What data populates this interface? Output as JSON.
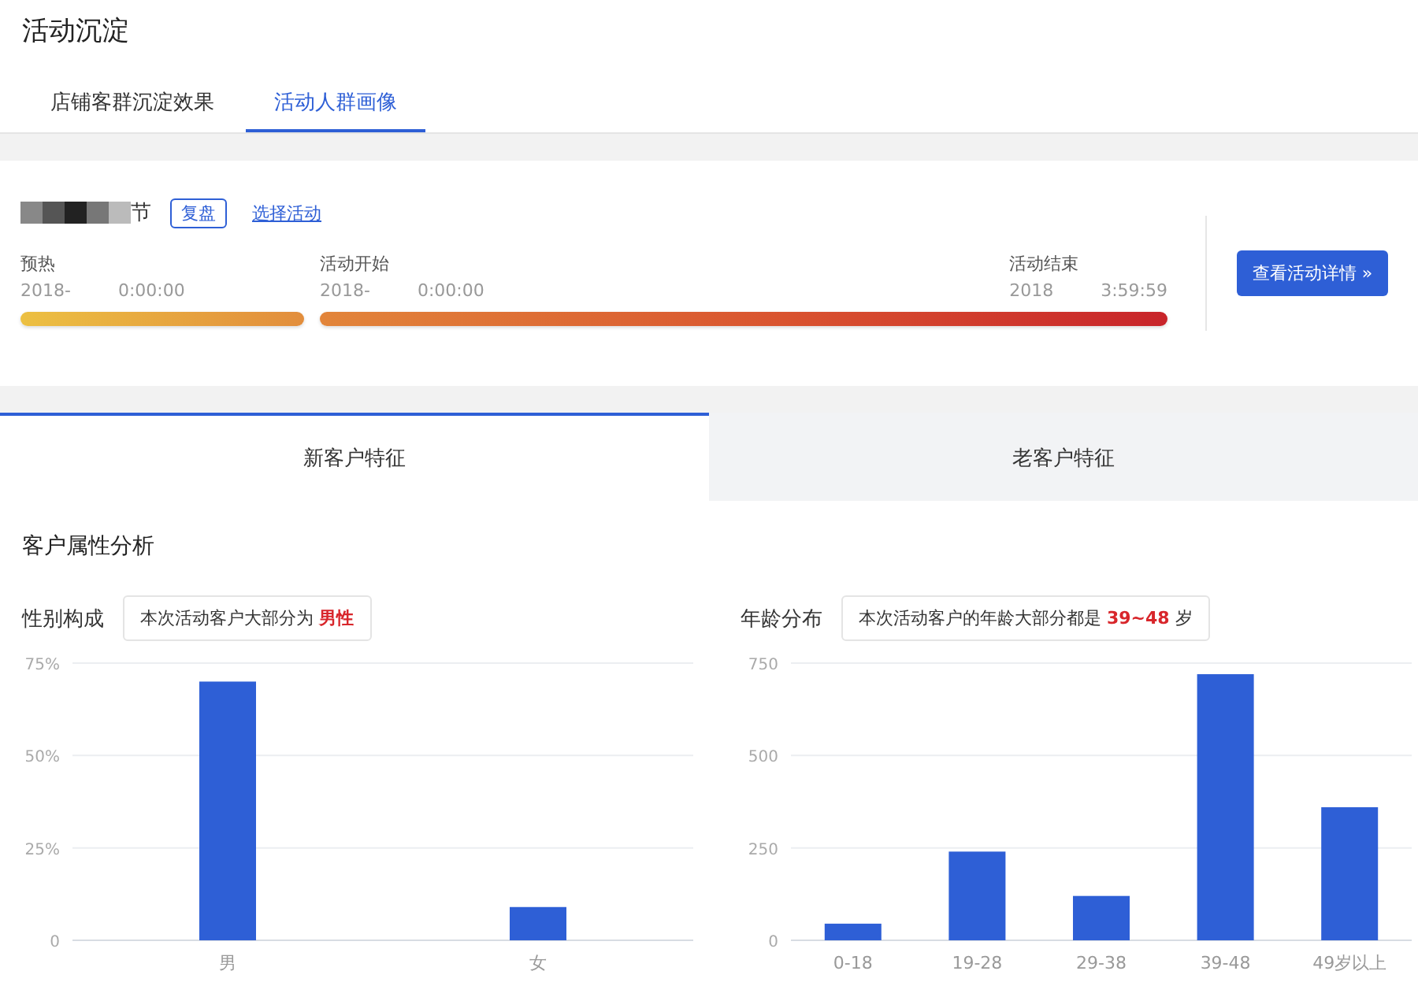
{
  "page_title": "活动沉淀",
  "tabs": [
    {
      "label": "店铺客群沉淀效果",
      "selected": false
    },
    {
      "label": "活动人群画像",
      "selected": true
    }
  ],
  "activity": {
    "name": "节",
    "tag": "复盘",
    "select_link": "选择活动",
    "detail_button": "查看活动详情 »",
    "segments": [
      {
        "kind": "warmup",
        "start": {
          "label": "预热",
          "date": "2018-",
          "time": "0:00:00"
        }
      },
      {
        "kind": "active",
        "start": {
          "label": "活动开始",
          "date": "2018-",
          "time": "0:00:00"
        },
        "end": {
          "label": "活动结束",
          "date": "2018",
          "time": "3:59:59"
        }
      }
    ]
  },
  "customer_tabs": [
    {
      "label": "新客户特征",
      "selected": true
    },
    {
      "label": "老客户特征",
      "selected": false
    }
  ],
  "section_title": "客户属性分析",
  "panels": [
    {
      "title": "性别构成",
      "note": "本次活动客户大部分为 **男性**",
      "chart_data": {
        "type": "bar",
        "categories": [
          "男",
          "女"
        ],
        "series": [
          {
            "color": "#2e5fd6",
            "values": [
              70,
              9
            ]
          }
        ],
        "ylim": [
          0,
          75
        ],
        "yticks": [
          {
            "value": 0,
            "label": "0"
          },
          {
            "value": 25,
            "label": "25%"
          },
          {
            "value": 50,
            "label": "50%"
          },
          {
            "value": 75,
            "label": "75%"
          }
        ]
      }
    },
    {
      "title": "年龄分布",
      "note": "本次活动客户的年龄大部分都是 **39~48** 岁",
      "chart_data": {
        "type": "bar",
        "categories": [
          "0-18",
          "19-28",
          "29-38",
          "39-48",
          "49岁以上"
        ],
        "series": [
          {
            "color": "#2e5fd6",
            "values": [
              45,
              240,
              120,
              720,
              360
            ]
          }
        ],
        "ylim": [
          0,
          750
        ],
        "yticks": [
          0,
          250,
          500,
          750
        ]
      }
    }
  ]
}
